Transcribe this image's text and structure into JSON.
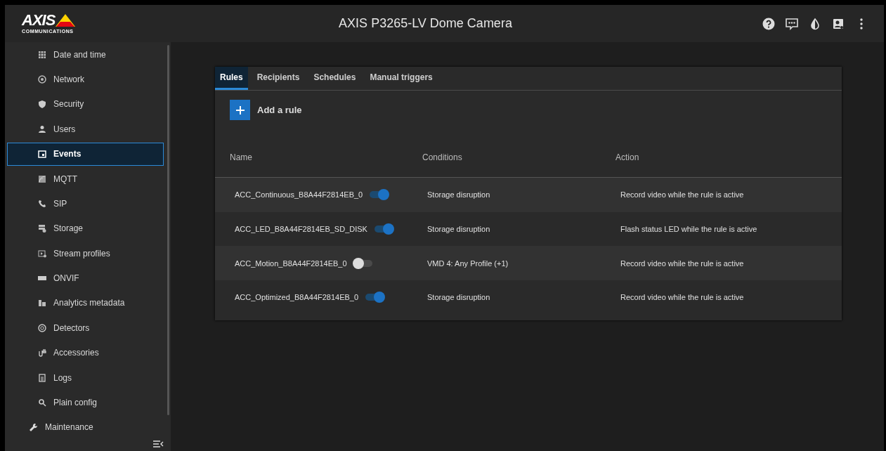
{
  "logo": {
    "name": "AXIS",
    "tagline": "COMMUNICATIONS"
  },
  "window": {
    "title": "AXIS P3265-LV Dome Camera"
  },
  "sidebar": {
    "items": [
      {
        "label": "Date and time",
        "selected": false
      },
      {
        "label": "Network",
        "selected": false
      },
      {
        "label": "Security",
        "selected": false
      },
      {
        "label": "Users",
        "selected": false
      },
      {
        "label": "Events",
        "selected": true
      },
      {
        "label": "MQTT",
        "selected": false
      },
      {
        "label": "SIP",
        "selected": false
      },
      {
        "label": "Storage",
        "selected": false
      },
      {
        "label": "Stream profiles",
        "selected": false
      },
      {
        "label": "ONVIF",
        "selected": false
      },
      {
        "label": "Analytics metadata",
        "selected": false
      },
      {
        "label": "Detectors",
        "selected": false
      },
      {
        "label": "Accessories",
        "selected": false
      },
      {
        "label": "Logs",
        "selected": false
      },
      {
        "label": "Plain config",
        "selected": false
      }
    ],
    "top_items": [
      {
        "label": "Maintenance",
        "selected": false
      }
    ]
  },
  "tabs": [
    {
      "label": "Rules",
      "selected": true
    },
    {
      "label": "Recipients",
      "selected": false
    },
    {
      "label": "Schedules",
      "selected": false
    },
    {
      "label": "Manual triggers",
      "selected": false
    }
  ],
  "add_button": {
    "label": "Add a rule"
  },
  "table": {
    "columns": [
      "Name",
      "Conditions",
      "Action"
    ],
    "rows": [
      {
        "name": "ACC_Continuous_B8A44F2814EB_0",
        "on": true,
        "condition": "Storage disruption",
        "action": "Record video while the rule is active"
      },
      {
        "name": "ACC_LED_B8A44F2814EB_SD_DISK",
        "on": true,
        "condition": "Storage disruption",
        "action": "Flash status LED while the rule is active"
      },
      {
        "name": "ACC_Motion_B8A44F2814EB_0",
        "on": false,
        "condition": "VMD 4: Any Profile (+1)",
        "action": "Record video while the rule is active"
      },
      {
        "name": "ACC_Optimized_B8A44F2814EB_0",
        "on": true,
        "condition": "Storage disruption",
        "action": "Record video while the rule is active"
      }
    ]
  }
}
